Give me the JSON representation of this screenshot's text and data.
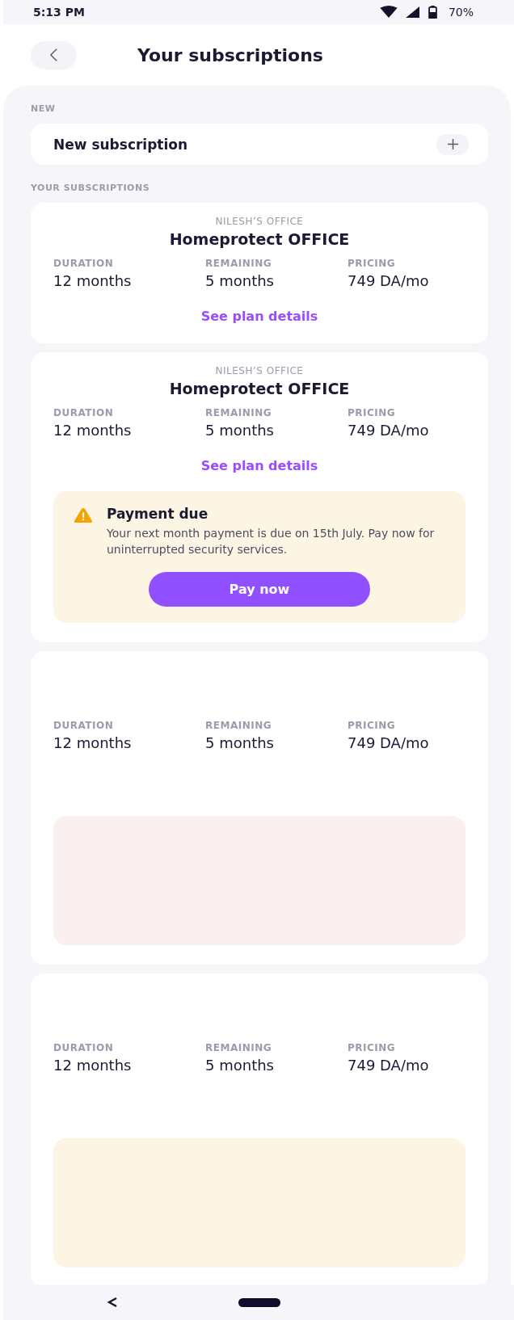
{
  "status_bar": {
    "time": "5:13 PM",
    "battery": "70%"
  },
  "header": {
    "title": "Your subscriptions"
  },
  "new_section": {
    "label": "NEW",
    "item": "New subscription"
  },
  "subscriptions_section": {
    "label": "YOUR SUBSCRIPTIONS"
  },
  "subscriptions": [
    {
      "location": "NILESH’S OFFICE",
      "plan": "Homeprotect OFFICE",
      "stats": [
        {
          "label": "DURATION",
          "value": "12 months"
        },
        {
          "label": "REMAINING",
          "value": "5 months"
        },
        {
          "label": "PRICING",
          "value": "749 DA/mo"
        }
      ],
      "link": "See plan details"
    },
    {
      "location": "NILESH’S OFFICE",
      "plan": "Homeprotect OFFICE",
      "stats": [
        {
          "label": "DURATION",
          "value": "12 months"
        },
        {
          "label": "REMAINING",
          "value": "5 months"
        },
        {
          "label": "PRICING",
          "value": "749 DA/mo"
        }
      ],
      "link": "See plan details",
      "alert": {
        "kind": "warning",
        "title": "Payment due",
        "message": "Your next month payment is due on 15th July. Pay now for uninterrupted security services.",
        "button": "Pay now"
      }
    },
    {
      "stats": [
        {
          "label": "DURATION",
          "value": "12 months"
        },
        {
          "label": "REMAINING",
          "value": "5 months"
        },
        {
          "label": "PRICING",
          "value": "749 DA/mo"
        }
      ],
      "alert": {
        "kind": "error"
      }
    },
    {
      "stats": [
        {
          "label": "DURATION",
          "value": "12 months"
        },
        {
          "label": "REMAINING",
          "value": "5 months"
        },
        {
          "label": "PRICING",
          "value": "749 DA/mo"
        }
      ],
      "alert": {
        "kind": "warning"
      }
    }
  ]
}
